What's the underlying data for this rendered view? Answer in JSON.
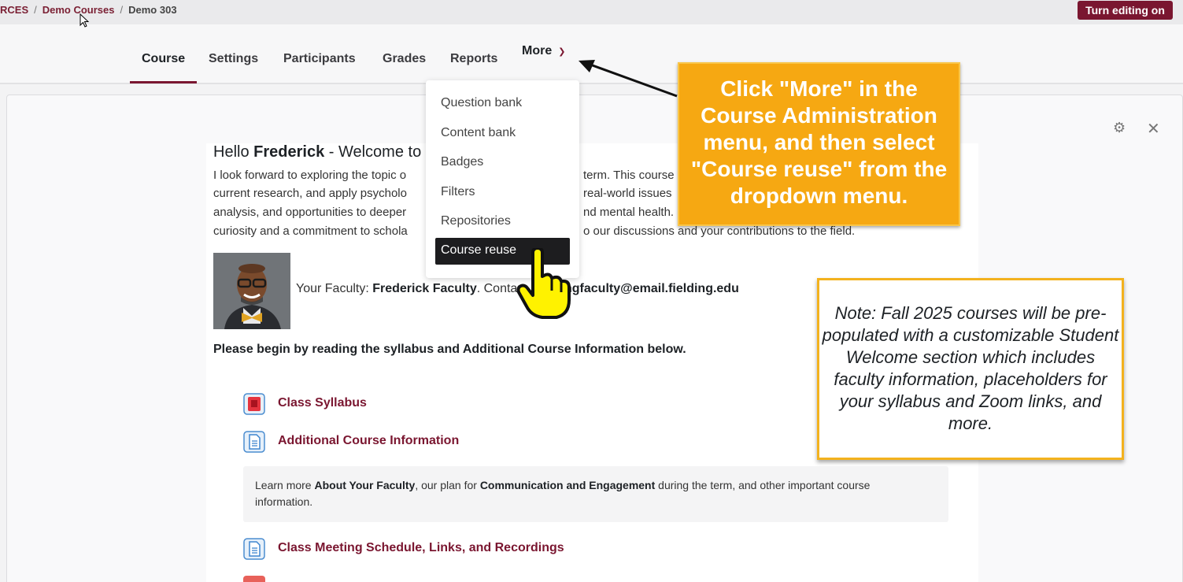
{
  "breadcrumb": {
    "first": "RCES",
    "second": "Demo Courses",
    "third": "Demo 303"
  },
  "edit_button": "Turn editing on",
  "nav": {
    "course": "Course",
    "settings": "Settings",
    "participants": "Participants",
    "grades": "Grades",
    "reports": "Reports",
    "more": "More"
  },
  "dropdown": {
    "items": [
      "Question bank",
      "Content bank",
      "Badges",
      "Filters",
      "Repositories"
    ],
    "active": "Course reuse"
  },
  "welcome": {
    "hello": "Hello ",
    "name": "Frederick",
    "rest": " - Welcome to S",
    "lines": [
      "I look forward to exploring the topic o",
      "current research, and apply psycholo",
      "analysis, and opportunities to deeper",
      "curiosity and a commitment to schola"
    ],
    "lines_right": [
      "term. This course",
      "real-world issues",
      "nd mental health.",
      "o our discussions and your contributions to the field."
    ],
    "faculty_label": "Your Faculty: ",
    "faculty_name": "Frederick Faculty",
    "contact_label": ".  Conta",
    "email": "ngfaculty@email.fielding.edu",
    "begin": "Please begin by reading the syllabus and Additional Course Information below."
  },
  "activities": {
    "syllabus": "Class Syllabus",
    "additional": "Additional Course Information",
    "schedule": "Class Meeting Schedule, Links, and Recordings"
  },
  "info": {
    "t1": "Learn more ",
    "b1": "About Your Faculty",
    "t2": ", our plan for ",
    "b2": "Communication and Engagement",
    "t3": " during the term, and other important course information."
  },
  "callouts": {
    "instruction": "Click \"More\" in the Course Administration menu, and then select \"Course reuse\" from the dropdown menu.",
    "note": "Note: Fall 2025 courses will be pre-populated with a customizable Student Welcome section which includes faculty information, placeholders for your syllabus and Zoom links, and more."
  },
  "icons": {
    "card_settings": "gear-icon",
    "card_close": "close-icon",
    "syllabus": "pdf-icon",
    "additional": "page-icon",
    "schedule": "page-icon",
    "more_chevron": "chevron-down-icon"
  },
  "colors": {
    "brand": "#7a1630",
    "callout_orange": "#f6a812",
    "note_border": "#f3b21e"
  }
}
